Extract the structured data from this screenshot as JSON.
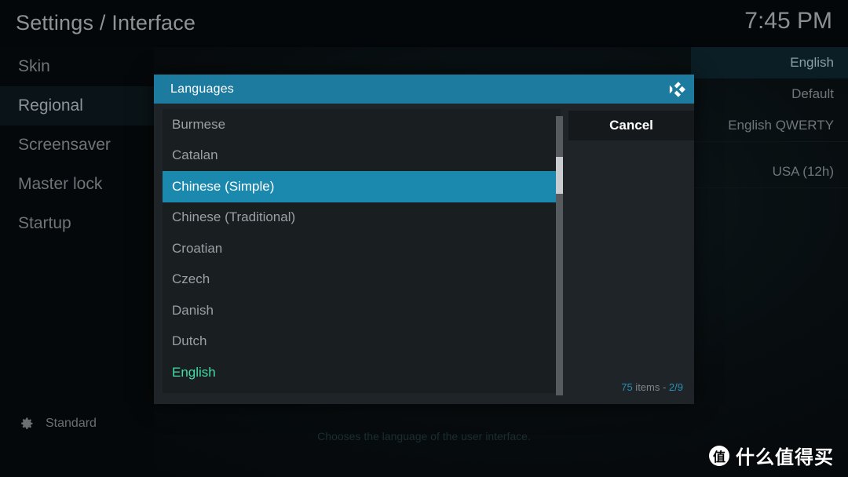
{
  "header": {
    "title": "Settings / Interface",
    "clock": "7:45 PM"
  },
  "sidebar": {
    "items": [
      {
        "label": "Skin",
        "selected": false
      },
      {
        "label": "Regional",
        "selected": true
      },
      {
        "label": "Screensaver",
        "selected": false
      },
      {
        "label": "Master lock",
        "selected": false
      },
      {
        "label": "Startup",
        "selected": false
      }
    ],
    "footer": {
      "icon": "gear-icon",
      "label": "Standard"
    }
  },
  "settings_values": [
    {
      "value": "English",
      "selected": true
    },
    {
      "value": "Default",
      "selected": false
    },
    {
      "value": "English QWERTY",
      "selected": false
    },
    {
      "value": "USA (12h)",
      "selected": false
    }
  ],
  "help_text": "Chooses the language of the user interface.",
  "dialog": {
    "title": "Languages",
    "logo_icon": "kodi-logo-icon",
    "cancel_label": "Cancel",
    "item_count": {
      "count": "75",
      "middle": " items - ",
      "page": "2/9",
      "full": "75 items - 2/9"
    },
    "list": [
      {
        "label": "Burmese",
        "state": "normal"
      },
      {
        "label": "Catalan",
        "state": "normal"
      },
      {
        "label": "Chinese (Simple)",
        "state": "selected"
      },
      {
        "label": "Chinese (Traditional)",
        "state": "normal"
      },
      {
        "label": "Croatian",
        "state": "normal"
      },
      {
        "label": "Czech",
        "state": "normal"
      },
      {
        "label": "Danish",
        "state": "normal"
      },
      {
        "label": "Dutch",
        "state": "normal"
      },
      {
        "label": "English",
        "state": "current"
      }
    ]
  },
  "watermark": {
    "badge": "值",
    "text": "什么值得买"
  },
  "colors": {
    "accent": "#1b88ad",
    "header_bar": "#1e7ba0",
    "current_item": "#44dba4",
    "count_accent": "#2b8fb5"
  }
}
